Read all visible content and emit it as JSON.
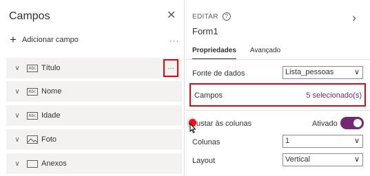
{
  "left_panel": {
    "title": "Campos",
    "close_icon": "close-icon",
    "add_field_label": "Adicionar campo",
    "add_more": "···",
    "fields": [
      {
        "label": "Título",
        "icon": "abc-text-icon"
      },
      {
        "label": "Nome",
        "icon": "abc-text-icon"
      },
      {
        "label": "Idade",
        "icon": "abc-text-icon"
      },
      {
        "label": "Foto",
        "icon": "image-icon"
      },
      {
        "label": "Anexos",
        "icon": "rectangle-icon"
      }
    ],
    "field_more": "···"
  },
  "right_panel": {
    "edit_label": "EDITAR",
    "form_name": "Form1",
    "tabs": {
      "properties": "Propriedades",
      "advanced": "Avançado"
    },
    "data_source_label": "Fonte de dados",
    "data_source_value": "Lista_pessoas",
    "fields_label": "Campos",
    "fields_value": "5 selecionado(s)",
    "snap_label": "Ajustar às colunas",
    "snap_label_visible": "ustar às colunas",
    "snap_state": "Ativado",
    "columns_label": "Colunas",
    "columns_value": "1",
    "layout_label": "Layout",
    "layout_value": "Vertical"
  },
  "colors": {
    "accent": "#742774",
    "highlight_border": "#d30d0d",
    "fields_value_color": "#6b2d7c"
  }
}
